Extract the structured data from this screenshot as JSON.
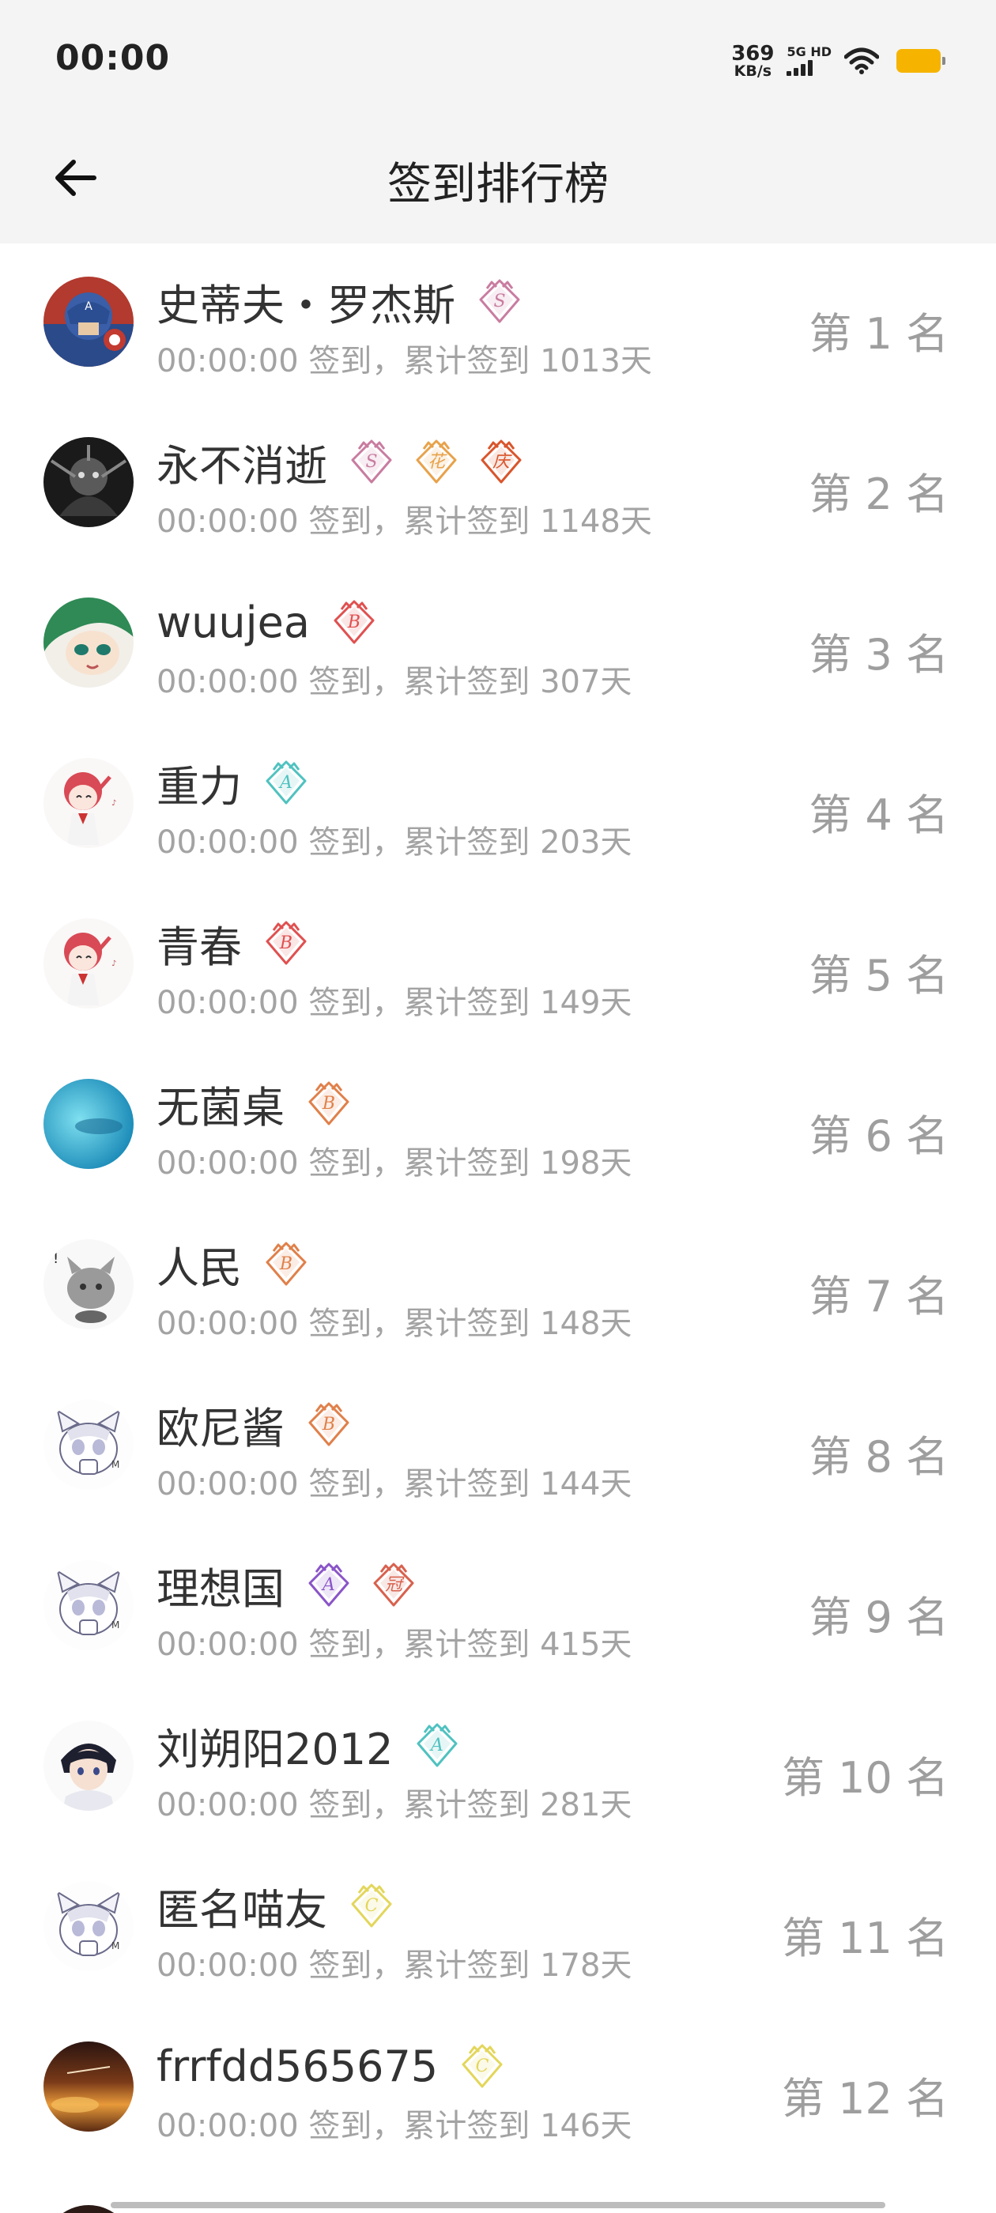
{
  "status_bar": {
    "time": "00:00",
    "net_speed_value": "369",
    "net_speed_unit": "KB/s",
    "signal_label": "5G HD",
    "icons": [
      "signal-icon",
      "wifi-icon",
      "battery-icon"
    ],
    "battery_color": "#f6b400"
  },
  "header": {
    "back_icon": "arrow-left-icon",
    "title": "签到排行榜"
  },
  "colors": {
    "name_text": "#333333",
    "meta_text": "#a3a3a3",
    "rank_text": "#9e9e9e",
    "header_bg": "#f4f4f4"
  },
  "rows": [
    {
      "name": "史蒂夫・罗杰斯",
      "meta": "00:00:00 签到，累计签到 1013天",
      "rank": "第 1 名",
      "avatar": "captain-america-avatar",
      "badges": [
        {
          "letter": "S",
          "color": "#c97ca0"
        }
      ]
    },
    {
      "name": "永不消逝",
      "meta": "00:00:00 签到，累计签到 1148天",
      "rank": "第 2 名",
      "avatar": "dark-mech-avatar",
      "badges": [
        {
          "letter": "S",
          "color": "#c97ca0"
        },
        {
          "letter": "花",
          "color": "#e8a24a"
        },
        {
          "letter": "庆",
          "color": "#d9552c"
        }
      ]
    },
    {
      "name": "wuujea",
      "meta": "00:00:00 签到，累计签到 307天",
      "rank": "第 3 名",
      "avatar": "green-hair-girl-avatar",
      "badges": [
        {
          "letter": "B",
          "color": "#e05050"
        }
      ]
    },
    {
      "name": "重力",
      "meta": "00:00:00 签到，累计签到 203天",
      "rank": "第 4 名",
      "avatar": "red-hair-girl-avatar",
      "badges": [
        {
          "letter": "A",
          "color": "#4fc2c0"
        }
      ]
    },
    {
      "name": "青春",
      "meta": "00:00:00 签到，累计签到 149天",
      "rank": "第 5 名",
      "avatar": "red-hair-girl-avatar",
      "badges": [
        {
          "letter": "B",
          "color": "#e05050"
        }
      ]
    },
    {
      "name": "无菌桌",
      "meta": "00:00:00 签到，累计签到 198天",
      "rank": "第 6 名",
      "avatar": "blue-ocean-avatar",
      "badges": [
        {
          "letter": "B",
          "color": "#e0804a"
        }
      ]
    },
    {
      "name": "人民",
      "meta": "00:00:00 签到，累计签到 148天",
      "rank": "第 7 名",
      "avatar": "grey-cat-avatar",
      "badges": [
        {
          "letter": "B",
          "color": "#e0804a"
        }
      ]
    },
    {
      "name": "欧尼酱",
      "meta": "00:00:00 签到，累计签到 144天",
      "rank": "第 8 名",
      "avatar": "default-cat-avatar",
      "badges": [
        {
          "letter": "B",
          "color": "#e0804a"
        }
      ]
    },
    {
      "name": "理想国",
      "meta": "00:00:00 签到，累计签到 415天",
      "rank": "第 9 名",
      "avatar": "default-cat-avatar",
      "badges": [
        {
          "letter": "A",
          "color": "#8a55c8"
        },
        {
          "letter": "冠",
          "color": "#d8614e"
        }
      ]
    },
    {
      "name": "刘朔阳2012",
      "meta": "00:00:00 签到，累计签到 281天",
      "rank": "第 10 名",
      "avatar": "anime-boy-avatar",
      "badges": [
        {
          "letter": "A",
          "color": "#4fc2c0"
        }
      ]
    },
    {
      "name": "匿名喵友",
      "meta": "00:00:00 签到，累计签到 178天",
      "rank": "第 11 名",
      "avatar": "default-cat-avatar",
      "badges": [
        {
          "letter": "C",
          "color": "#e3d65a"
        }
      ]
    },
    {
      "name": "frrfdd565675",
      "meta": "00:00:00 签到，累计签到 146天",
      "rank": "第 12 名",
      "avatar": "sunset-clouds-avatar",
      "badges": [
        {
          "letter": "C",
          "color": "#e3d65a"
        }
      ]
    }
  ]
}
